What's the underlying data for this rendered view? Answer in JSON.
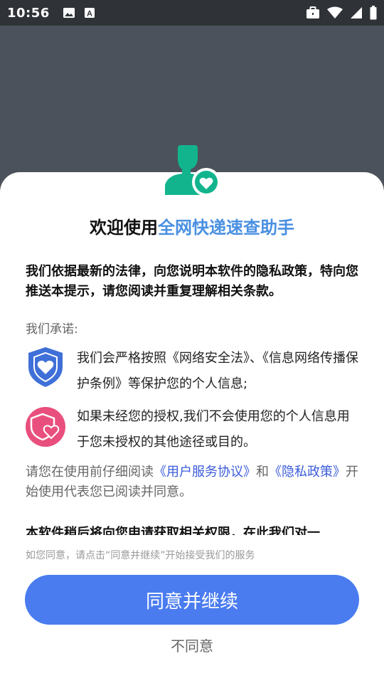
{
  "status_bar": {
    "time": "10:56",
    "left_icons": [
      "image-icon",
      "a-notification-icon"
    ],
    "right_icons": [
      "briefcase-icon",
      "wifi-icon",
      "signal-icon",
      "battery-icon"
    ]
  },
  "dialog": {
    "title_prefix": "欢迎使用",
    "title_app_name": "全网快递速查助手",
    "intro": "我们依据最新的法律，向您说明本软件的隐私政策，特向您推送本提示，请您阅读并重复理解相关条款。",
    "promise_label": "我们承诺:",
    "promises": [
      {
        "icon": "shield-heart-icon",
        "text": "我们会严格按照《网络安全法》、《信息网络传播保护条例》等保护您的个人信息;"
      },
      {
        "icon": "shield-heart-circle-icon",
        "text": "如果未经您的授权,我们不会使用您的个人信息用于您未授权的其他途径或目的。"
      }
    ],
    "notice": {
      "before": "请您在使用前仔细阅读",
      "link1": "《用户服务协议》",
      "middle": "和",
      "link2": "《隐私政策》",
      "after": "开始使用代表您已阅读并同意。"
    },
    "cutoff_text": "本软件稍后将向您申请获取相关权限，在此我们对一",
    "hint": "如您同意，请点击“同意并继续”开始接受我们的服务",
    "agree_label": "同意并继续",
    "disagree_label": "不同意"
  },
  "colors": {
    "accent": "#4a7cf0",
    "title_highlight": "#4a90e2",
    "link": "#3b5bdb",
    "hero_icon": "#12b48e",
    "shield_blue": "#3f6fd8",
    "badge_pink": "#e94f7d"
  }
}
